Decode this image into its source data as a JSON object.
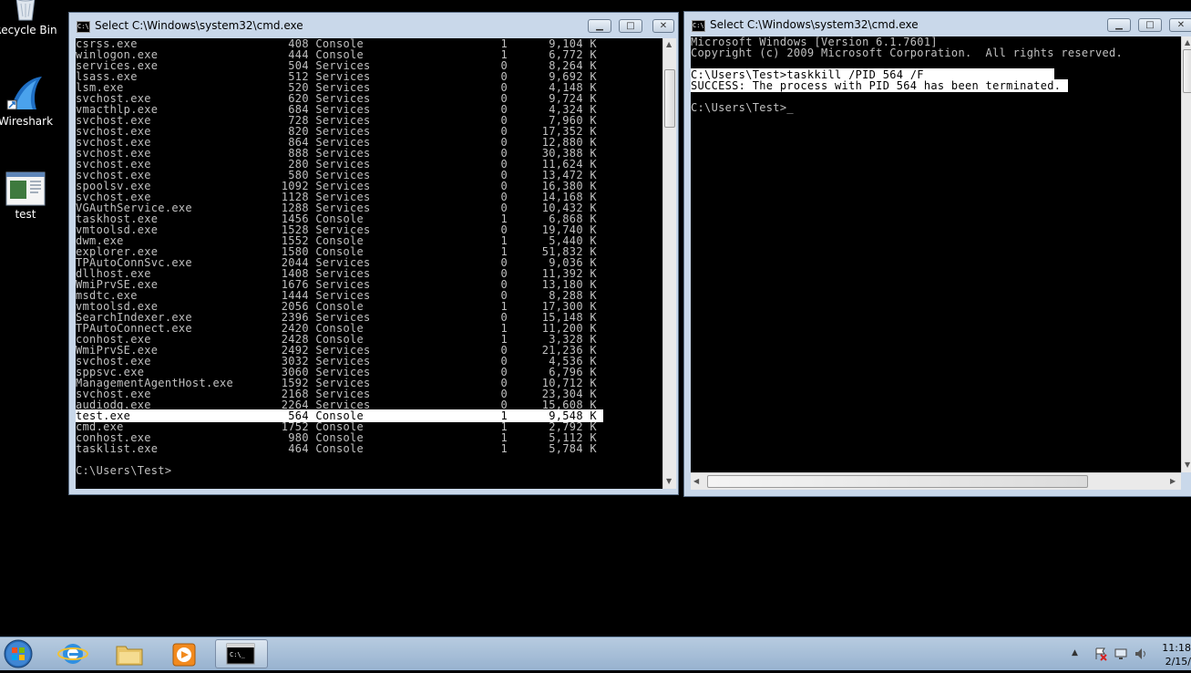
{
  "desktop": {
    "icons": [
      {
        "label": "Recycle Bin",
        "icon": "recycle-bin-icon"
      },
      {
        "label": "Wireshark",
        "icon": "wireshark-icon"
      },
      {
        "label": "test",
        "icon": "file-icon"
      }
    ]
  },
  "window_left": {
    "title": "Select C:\\Windows\\system32\\cmd.exe",
    "rows": [
      {
        "name": "csrss.exe",
        "pid": "408",
        "session": "Console",
        "num": "1",
        "mem": "9,104 K"
      },
      {
        "name": "winlogon.exe",
        "pid": "444",
        "session": "Console",
        "num": "1",
        "mem": "6,772 K"
      },
      {
        "name": "services.exe",
        "pid": "504",
        "session": "Services",
        "num": "0",
        "mem": "8,264 K"
      },
      {
        "name": "lsass.exe",
        "pid": "512",
        "session": "Services",
        "num": "0",
        "mem": "9,692 K"
      },
      {
        "name": "lsm.exe",
        "pid": "520",
        "session": "Services",
        "num": "0",
        "mem": "4,148 K"
      },
      {
        "name": "svchost.exe",
        "pid": "620",
        "session": "Services",
        "num": "0",
        "mem": "9,724 K"
      },
      {
        "name": "vmacthlp.exe",
        "pid": "684",
        "session": "Services",
        "num": "0",
        "mem": "4,324 K"
      },
      {
        "name": "svchost.exe",
        "pid": "728",
        "session": "Services",
        "num": "0",
        "mem": "7,960 K"
      },
      {
        "name": "svchost.exe",
        "pid": "820",
        "session": "Services",
        "num": "0",
        "mem": "17,352 K"
      },
      {
        "name": "svchost.exe",
        "pid": "864",
        "session": "Services",
        "num": "0",
        "mem": "12,880 K"
      },
      {
        "name": "svchost.exe",
        "pid": "888",
        "session": "Services",
        "num": "0",
        "mem": "30,388 K"
      },
      {
        "name": "svchost.exe",
        "pid": "280",
        "session": "Services",
        "num": "0",
        "mem": "11,624 K"
      },
      {
        "name": "svchost.exe",
        "pid": "580",
        "session": "Services",
        "num": "0",
        "mem": "13,472 K"
      },
      {
        "name": "spoolsv.exe",
        "pid": "1092",
        "session": "Services",
        "num": "0",
        "mem": "16,380 K"
      },
      {
        "name": "svchost.exe",
        "pid": "1128",
        "session": "Services",
        "num": "0",
        "mem": "14,168 K"
      },
      {
        "name": "VGAuthService.exe",
        "pid": "1288",
        "session": "Services",
        "num": "0",
        "mem": "10,432 K"
      },
      {
        "name": "taskhost.exe",
        "pid": "1456",
        "session": "Console",
        "num": "1",
        "mem": "6,868 K"
      },
      {
        "name": "vmtoolsd.exe",
        "pid": "1528",
        "session": "Services",
        "num": "0",
        "mem": "19,740 K"
      },
      {
        "name": "dwm.exe",
        "pid": "1552",
        "session": "Console",
        "num": "1",
        "mem": "5,440 K"
      },
      {
        "name": "explorer.exe",
        "pid": "1580",
        "session": "Console",
        "num": "1",
        "mem": "51,832 K"
      },
      {
        "name": "TPAutoConnSvc.exe",
        "pid": "2044",
        "session": "Services",
        "num": "0",
        "mem": "9,036 K"
      },
      {
        "name": "dllhost.exe",
        "pid": "1408",
        "session": "Services",
        "num": "0",
        "mem": "11,392 K"
      },
      {
        "name": "WmiPrvSE.exe",
        "pid": "1676",
        "session": "Services",
        "num": "0",
        "mem": "13,180 K"
      },
      {
        "name": "msdtc.exe",
        "pid": "1444",
        "session": "Services",
        "num": "0",
        "mem": "8,288 K"
      },
      {
        "name": "vmtoolsd.exe",
        "pid": "2056",
        "session": "Console",
        "num": "1",
        "mem": "17,300 K"
      },
      {
        "name": "SearchIndexer.exe",
        "pid": "2396",
        "session": "Services",
        "num": "0",
        "mem": "15,148 K"
      },
      {
        "name": "TPAutoConnect.exe",
        "pid": "2420",
        "session": "Console",
        "num": "1",
        "mem": "11,200 K"
      },
      {
        "name": "conhost.exe",
        "pid": "2428",
        "session": "Console",
        "num": "1",
        "mem": "3,328 K"
      },
      {
        "name": "WmiPrvSE.exe",
        "pid": "2492",
        "session": "Services",
        "num": "0",
        "mem": "21,236 K"
      },
      {
        "name": "svchost.exe",
        "pid": "3032",
        "session": "Services",
        "num": "0",
        "mem": "4,536 K"
      },
      {
        "name": "sppsvc.exe",
        "pid": "3060",
        "session": "Services",
        "num": "0",
        "mem": "6,796 K"
      },
      {
        "name": "ManagementAgentHost.exe",
        "pid": "1592",
        "session": "Services",
        "num": "0",
        "mem": "10,712 K"
      },
      {
        "name": "svchost.exe",
        "pid": "2168",
        "session": "Services",
        "num": "0",
        "mem": "23,304 K"
      },
      {
        "name": "audiodg.exe",
        "pid": "2264",
        "session": "Services",
        "num": "0",
        "mem": "15,608 K"
      },
      {
        "name": "test.exe",
        "pid": "564",
        "session": "Console",
        "num": "1",
        "mem": "9,548 K",
        "highlighted": true
      },
      {
        "name": "cmd.exe",
        "pid": "1752",
        "session": "Console",
        "num": "1",
        "mem": "2,792 K"
      },
      {
        "name": "conhost.exe",
        "pid": "980",
        "session": "Console",
        "num": "1",
        "mem": "5,112 K"
      },
      {
        "name": "tasklist.exe",
        "pid": "464",
        "session": "Console",
        "num": "1",
        "mem": "5,784 K"
      }
    ],
    "prompt": "C:\\Users\\Test>"
  },
  "window_right": {
    "title": "Select C:\\Windows\\system32\\cmd.exe",
    "line1": "Microsoft Windows [Version 6.1.7601]",
    "line2": "Copyright (c) 2009 Microsoft Corporation.  All rights reserved.",
    "cmd": "C:\\Users\\Test>taskkill /PID 564 /F",
    "result": "SUCCESS: The process with PID 564 has been terminated.",
    "prompt": "C:\\Users\\Test>",
    "cursor": "_"
  },
  "taskbar": {
    "items": [
      {
        "icon": "windows-start-icon"
      },
      {
        "icon": "internet-explorer-icon"
      },
      {
        "icon": "file-explorer-icon"
      },
      {
        "icon": "media-player-icon"
      },
      {
        "icon": "command-prompt-icon",
        "label": "C:\\_",
        "active": true
      }
    ],
    "clock_time": "11:18",
    "clock_date": "2/15/"
  }
}
